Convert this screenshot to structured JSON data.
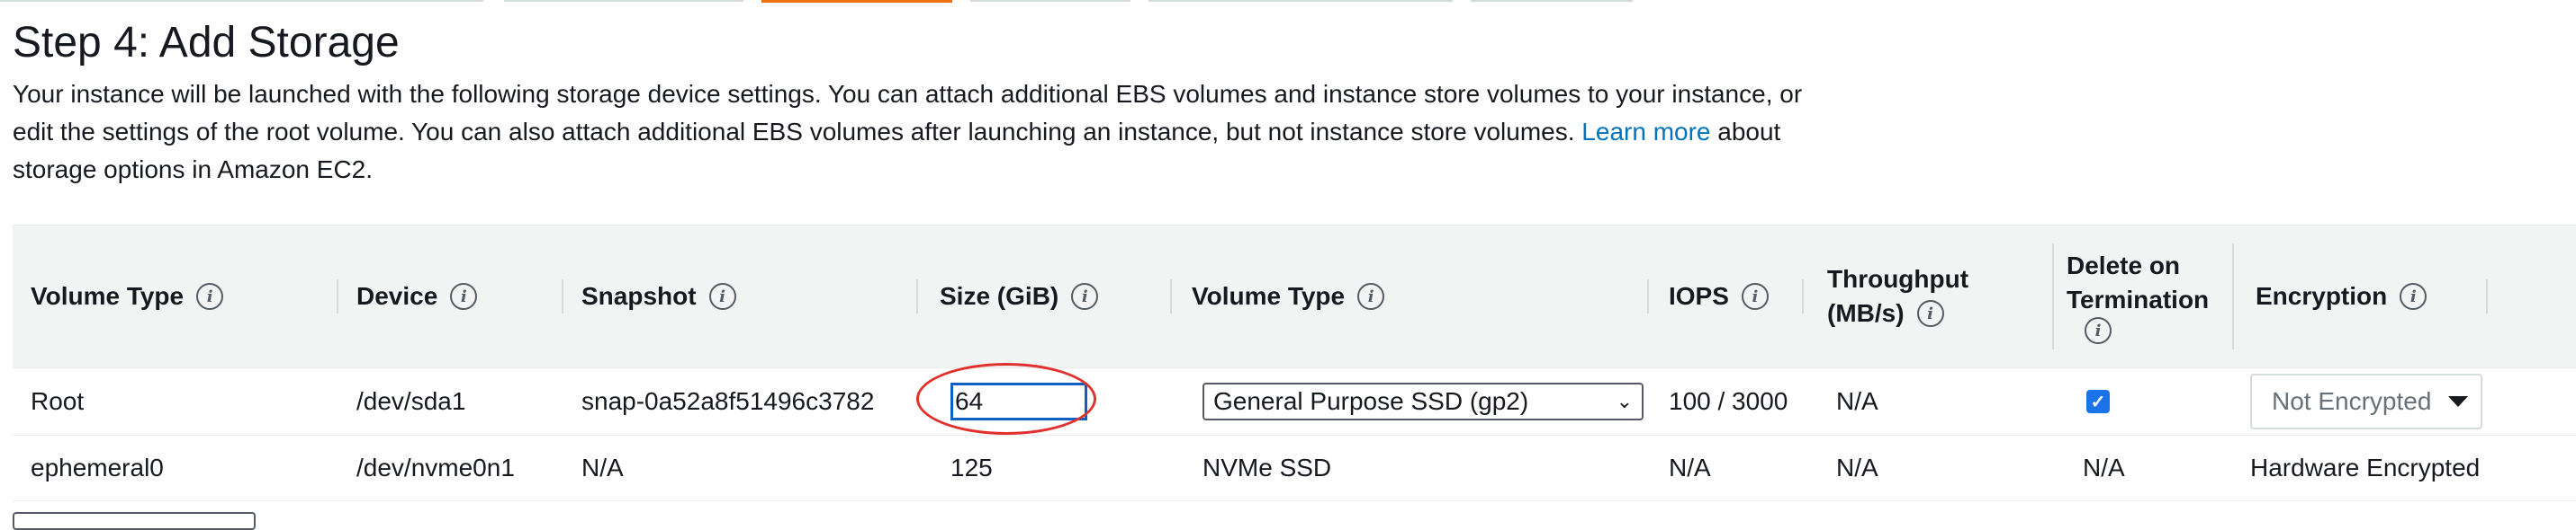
{
  "page": {
    "title": "Step 4: Add Storage",
    "desc_1": "Your instance will be launched with the following storage device settings. You can attach additional EBS volumes and instance store volumes to your instance, or edit the settings of the root volume. You can also attach additional EBS volumes after launching an instance, but not instance store volumes.",
    "learn_more": "Learn more",
    "desc_2": "about storage options in Amazon EC2."
  },
  "table": {
    "headers": {
      "volume_type": "Volume Type",
      "device": "Device",
      "snapshot": "Snapshot",
      "size": "Size (GiB)",
      "volume_type_2": "Volume Type",
      "iops": "IOPS",
      "throughput_1": "Throughput",
      "throughput_2": "(MB/s)",
      "delete_1": "Delete on",
      "delete_2": "Termination",
      "encryption": "Encryption"
    },
    "info_glyph": "i",
    "rows": [
      {
        "volume_type": "Root",
        "device": "/dev/sda1",
        "snapshot": "snap-0a52a8f51496c3782",
        "size": "64",
        "vol_type_select": "General Purpose SSD (gp2)",
        "iops": "100 / 3000",
        "throughput": "N/A",
        "delete_on_termination": true,
        "encryption_select": "Not Encrypted"
      },
      {
        "volume_type": "ephemeral0",
        "device": "/dev/nvme0n1",
        "snapshot": "N/A",
        "size": "125",
        "vol_type": "NVMe SSD",
        "iops": "N/A",
        "throughput": "N/A",
        "delete_on_termination": "N/A",
        "encryption": "Hardware Encrypted"
      }
    ]
  },
  "colors": {
    "link": "#0073bb",
    "header_bg": "#f2f3f3",
    "active_tab": "#ec7211",
    "highlight_oval": "#e0312e",
    "focus_border": "#0f5fc2",
    "checkbox": "#1a73e8"
  },
  "icons": {
    "info": "info-icon",
    "select_chevron": "chevron-down-icon",
    "dropdown_caret": "caret-down-icon",
    "checkmark": "checkmark-icon"
  }
}
